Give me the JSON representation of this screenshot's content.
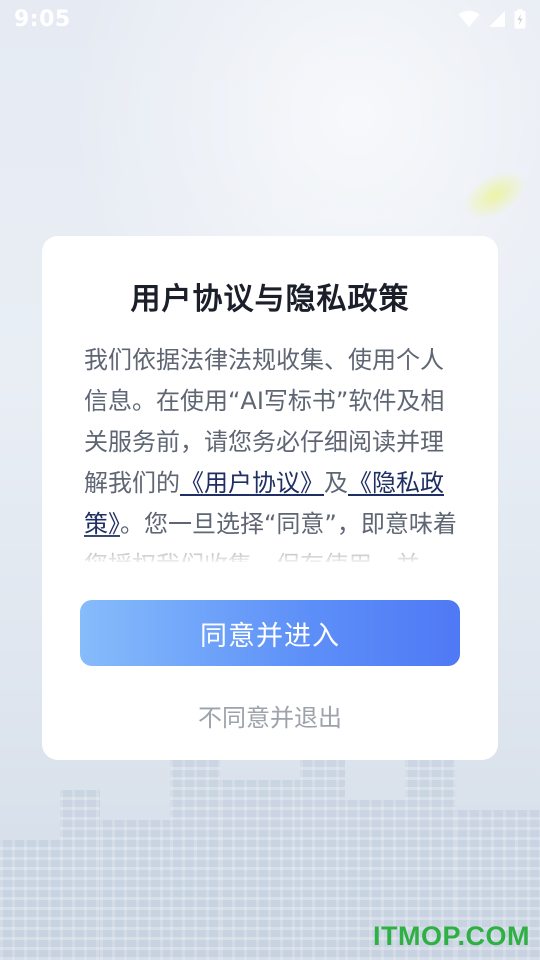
{
  "status_bar": {
    "time": "9:05",
    "icons": [
      "wifi-icon",
      "signal-icon",
      "battery-charging-icon"
    ]
  },
  "dialog": {
    "title": "用户协议与隐私政策",
    "body": {
      "text_1": "我们依据法律法规收集、使用个人信息。在使用“AI写标书”软件及相关服务前，请您务必仔细阅读并理解我们的",
      "link_user_agreement": "《用户协议》",
      "text_2": "及",
      "link_privacy_policy": "《隐私政策》",
      "text_3": "。您一旦选择“同意”，即意味着您授权我们收集、保存使用，并"
    },
    "agree_button": "同意并进入",
    "decline_button": "不同意并退出"
  },
  "watermark": "ITMOP.COM",
  "colors": {
    "accent_gradient_start": "#86bcfb",
    "accent_gradient_end": "#4f79f5",
    "link": "#1f2f63",
    "watermark": "#2fb043"
  }
}
